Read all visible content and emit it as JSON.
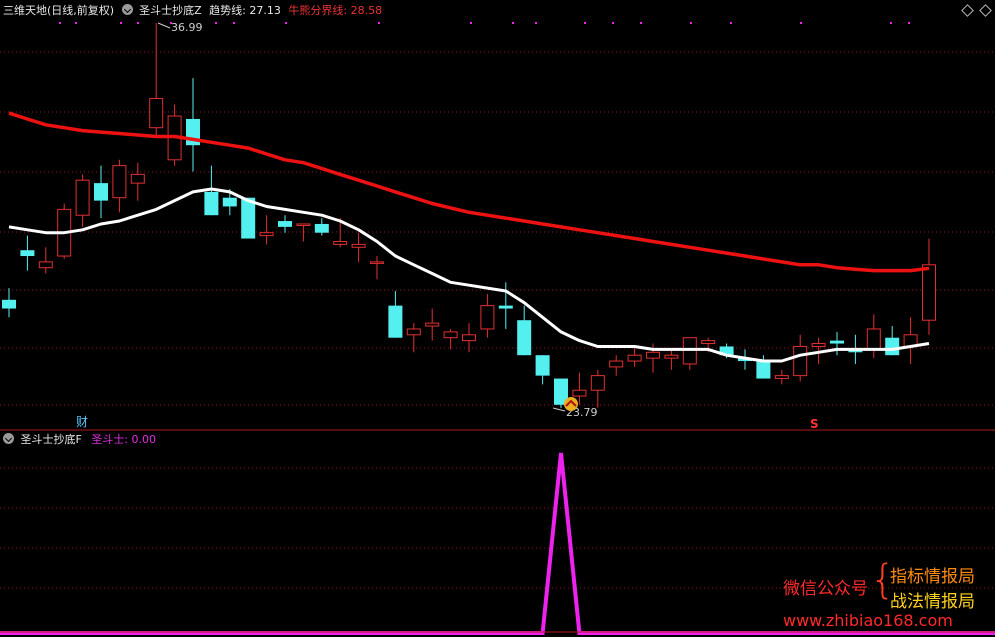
{
  "main_panel": {
    "title": "三维天地(日线,前复权)",
    "indicator_name": "圣斗士抄底Z",
    "trend_label": "趋势线:",
    "trend_value": "27.13",
    "bullbear_label": "牛熊分界线:",
    "bullbear_value": "28.58",
    "high_label": "36.99",
    "low_label": "23.79",
    "cai_marker": "财",
    "s_marker": "S"
  },
  "sub_panel": {
    "indicator_name": "圣斗士抄底F",
    "series_label": "圣斗士:",
    "series_value": "0.00"
  },
  "watermark": {
    "left_text": "微信公众号",
    "right_top": "指标情报局",
    "right_bottom": "战法情报局",
    "url": "www.zhibiao168.com"
  },
  "colors": {
    "up": "#e23030",
    "down": "#54f0f0",
    "bullbear_line": "#ee1111",
    "trend_line": "#ffffff",
    "signal": "#ee22ee",
    "grid": "#8a1a1a"
  },
  "chart_data": [
    {
      "type": "candlestick",
      "series": [
        {
          "name": "K线",
          "ohlc": [
            [
              27.5,
              27.9,
              26.9,
              27.2
            ],
            [
              29.2,
              29.7,
              28.5,
              29.0
            ],
            [
              28.6,
              29.3,
              28.4,
              28.8
            ],
            [
              29.0,
              30.8,
              28.9,
              30.6
            ],
            [
              30.4,
              31.8,
              30.0,
              31.6
            ],
            [
              31.5,
              32.1,
              30.3,
              30.9
            ],
            [
              31.0,
              32.3,
              30.5,
              32.1
            ],
            [
              31.5,
              32.2,
              30.9,
              31.8
            ],
            [
              33.4,
              36.99,
              33.1,
              34.4
            ],
            [
              32.3,
              34.2,
              32.1,
              33.8
            ],
            [
              33.7,
              35.1,
              31.9,
              32.8
            ],
            [
              31.2,
              32.1,
              30.4,
              30.4
            ],
            [
              31.0,
              31.3,
              30.4,
              30.7
            ],
            [
              31.0,
              31.0,
              29.6,
              29.6
            ],
            [
              29.7,
              30.4,
              29.4,
              29.8
            ],
            [
              30.2,
              30.4,
              29.8,
              30.0
            ],
            [
              30.1,
              30.1,
              29.5,
              30.1
            ],
            [
              30.1,
              30.3,
              29.7,
              29.8
            ],
            [
              29.4,
              30.3,
              29.3,
              29.5
            ],
            [
              29.3,
              29.8,
              28.8,
              29.4
            ],
            [
              28.8,
              29.0,
              28.2,
              28.8
            ],
            [
              27.3,
              27.8,
              26.2,
              26.2
            ],
            [
              26.3,
              26.7,
              25.7,
              26.5
            ],
            [
              26.6,
              27.2,
              26.1,
              26.7
            ],
            [
              26.2,
              26.5,
              25.8,
              26.4
            ],
            [
              26.1,
              26.7,
              25.7,
              26.3
            ],
            [
              26.5,
              27.7,
              26.2,
              27.3
            ],
            [
              27.3,
              28.1,
              26.5,
              27.2
            ],
            [
              26.8,
              27.3,
              25.6,
              25.6
            ],
            [
              25.6,
              25.6,
              24.6,
              24.9
            ],
            [
              24.8,
              24.8,
              23.79,
              23.9
            ],
            [
              24.2,
              25.0,
              23.9,
              24.4
            ],
            [
              24.4,
              25.1,
              23.8,
              24.9
            ],
            [
              25.2,
              25.6,
              24.9,
              25.4
            ],
            [
              25.4,
              25.9,
              25.2,
              25.6
            ],
            [
              25.5,
              26.0,
              25.0,
              25.7
            ],
            [
              25.5,
              25.8,
              25.1,
              25.6
            ],
            [
              25.3,
              26.2,
              25.1,
              26.2
            ],
            [
              26.0,
              26.2,
              25.7,
              26.1
            ],
            [
              25.9,
              26.0,
              25.5,
              25.6
            ],
            [
              25.5,
              25.8,
              25.1,
              25.4
            ],
            [
              25.4,
              25.6,
              24.8,
              24.8
            ],
            [
              24.8,
              25.1,
              24.6,
              24.9
            ],
            [
              24.9,
              26.3,
              24.7,
              25.9
            ],
            [
              25.9,
              26.2,
              25.3,
              26.0
            ],
            [
              26.1,
              26.4,
              25.6,
              26.0
            ],
            [
              25.8,
              26.3,
              25.3,
              25.7
            ],
            [
              25.8,
              27.0,
              25.5,
              26.5
            ],
            [
              26.2,
              26.6,
              25.6,
              25.6
            ],
            [
              25.9,
              26.9,
              25.3,
              26.3
            ],
            [
              26.8,
              29.6,
              26.3,
              28.7
            ]
          ]
        },
        {
          "name": "趋势线",
          "values": [
            30.0,
            29.9,
            29.8,
            29.8,
            29.9,
            30.1,
            30.2,
            30.4,
            30.6,
            30.9,
            31.2,
            31.3,
            31.2,
            30.9,
            30.7,
            30.6,
            30.5,
            30.4,
            30.2,
            29.9,
            29.5,
            29.0,
            28.7,
            28.4,
            28.1,
            28.0,
            27.9,
            27.8,
            27.4,
            26.9,
            26.4,
            26.1,
            25.9,
            25.9,
            25.9,
            25.8,
            25.8,
            25.8,
            25.8,
            25.6,
            25.5,
            25.4,
            25.4,
            25.6,
            25.7,
            25.8,
            25.8,
            25.8,
            25.8,
            25.9,
            26.0
          ]
        },
        {
          "name": "牛熊分界线",
          "values": [
            33.9,
            33.7,
            33.5,
            33.4,
            33.3,
            33.25,
            33.2,
            33.15,
            33.1,
            33.1,
            33.0,
            32.9,
            32.8,
            32.7,
            32.5,
            32.3,
            32.2,
            32.0,
            31.8,
            31.6,
            31.4,
            31.2,
            31.0,
            30.8,
            30.65,
            30.5,
            30.4,
            30.3,
            30.2,
            30.1,
            30.0,
            29.9,
            29.8,
            29.7,
            29.6,
            29.5,
            29.4,
            29.3,
            29.2,
            29.1,
            29.0,
            28.9,
            28.8,
            28.7,
            28.7,
            28.6,
            28.55,
            28.5,
            28.5,
            28.5,
            28.58
          ]
        }
      ]
    },
    {
      "type": "line",
      "series": [
        {
          "name": "圣斗士",
          "values": [
            0,
            0,
            0,
            0,
            0,
            0,
            0,
            0,
            0,
            0,
            0,
            0,
            0,
            0,
            0,
            0,
            0,
            0,
            0,
            0,
            0,
            0,
            0,
            0,
            0,
            0,
            0,
            0,
            0,
            0,
            1,
            0,
            0,
            0,
            0,
            0,
            0,
            0,
            0,
            0,
            0,
            0,
            0,
            0,
            0,
            0,
            0,
            0,
            0,
            0,
            0
          ]
        }
      ]
    }
  ]
}
